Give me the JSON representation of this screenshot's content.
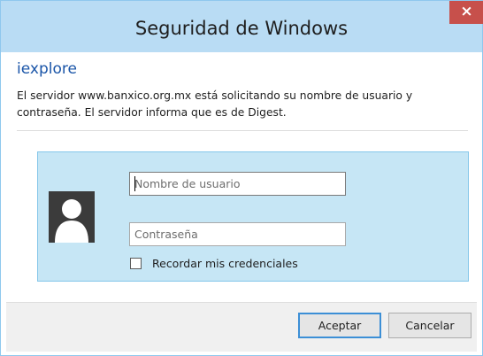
{
  "window": {
    "title": "Seguridad de Windows",
    "close_symbol": "×"
  },
  "content": {
    "app_name": "iexplore",
    "message_line1": "El servidor www.banxico.org.mx está solicitando su nombre de usuario y",
    "message_line2": "contraseña. El servidor informa que es de Digest."
  },
  "credentials": {
    "username_placeholder": "Nombre de usuario",
    "username_value": "",
    "password_placeholder": "Contraseña",
    "password_value": "",
    "remember_label": "Recordar mis credenciales",
    "remember_checked": false
  },
  "footer": {
    "ok_label": "Aceptar",
    "cancel_label": "Cancelar"
  },
  "colors": {
    "titlebar": "#b9dcf4",
    "close_button": "#c7504b",
    "app_name": "#1a55a8",
    "credential_tile": "#c6e6f5",
    "default_button_border": "#3c8fd6"
  },
  "icons": {
    "close": "close-icon",
    "avatar": "user-avatar-icon"
  }
}
